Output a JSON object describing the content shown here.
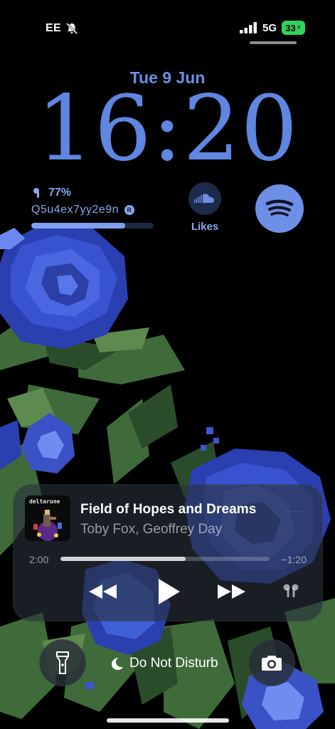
{
  "status_bar": {
    "carrier": "EE",
    "network": "5G",
    "battery_level": "33",
    "silent_mode_icon": "bell-slash-icon",
    "signal_icon": "signal-bars-icon",
    "charging_icon": "bolt-icon"
  },
  "lock_screen": {
    "date": "Tue 9 Jun",
    "time": "16:20"
  },
  "widgets": {
    "device_battery": {
      "icon": "airpod-icon",
      "percent_text": "77%",
      "percent_value": 77,
      "device_name": "Q5u4ex7yy2e9n",
      "badge": "R"
    },
    "soundcloud": {
      "icon": "soundcloud-icon",
      "label": "Likes"
    },
    "spotify": {
      "icon": "spotify-icon"
    }
  },
  "now_playing": {
    "album_art_text": "deltarune",
    "title": "Field of Hopes and Dreams",
    "artist": "Toby Fox, Geoffrey Day",
    "elapsed": "2:00",
    "remaining": "−1:20",
    "progress_fraction": 0.6,
    "controls": [
      "rewind-icon",
      "play-icon",
      "fast-forward-icon",
      "airpods-output-icon"
    ]
  },
  "bottom_bar": {
    "flashlight_icon": "flashlight-icon",
    "focus_icon": "moon-icon",
    "focus_label": "Do Not Disturb",
    "camera_icon": "camera-icon"
  },
  "colors": {
    "accent_blue": "#5f86e0",
    "widget_blue": "#8aa8ef",
    "battery_green": "#2fd35a"
  }
}
